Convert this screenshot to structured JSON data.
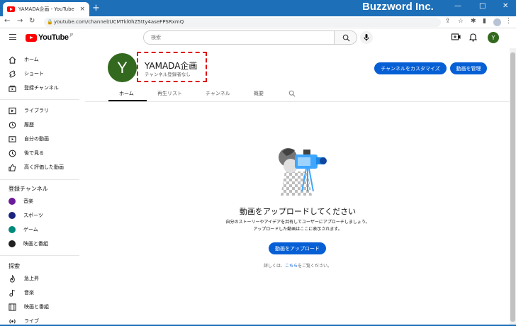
{
  "browser": {
    "tab_title": "YAMADA企画 - YouTube",
    "tab_close": "×",
    "new_tab": "+",
    "brand_overlay": "Buzzword Inc.",
    "url": "youtube.com/channel/UCMTkl0hZ5tty4aseFPSRxmQ",
    "window_controls": [
      "—",
      "□",
      "✕"
    ]
  },
  "header": {
    "logo_text": "YouTube",
    "logo_region": "JP",
    "search_placeholder": "検索",
    "user_initial": "Y"
  },
  "sidebar": {
    "main_items": [
      {
        "label": "ホーム",
        "icon": "home-icon"
      },
      {
        "label": "ショート",
        "icon": "shorts-icon"
      },
      {
        "label": "登録チャンネル",
        "icon": "subscriptions-icon"
      }
    ],
    "library_items": [
      {
        "label": "ライブラリ",
        "icon": "library-icon"
      },
      {
        "label": "履歴",
        "icon": "history-icon"
      },
      {
        "label": "自分の動画",
        "icon": "your-videos-icon"
      },
      {
        "label": "後で見る",
        "icon": "watch-later-icon"
      },
      {
        "label": "高く評価した動画",
        "icon": "liked-videos-icon"
      }
    ],
    "subscriptions_title": "登録チャンネル",
    "subscriptions": [
      {
        "label": "音楽",
        "color": "#6a1b9a"
      },
      {
        "label": "スポーツ",
        "color": "#1a237e"
      },
      {
        "label": "ゲーム",
        "color": "#00897b"
      },
      {
        "label": "映画と番組",
        "color": "#212121"
      }
    ],
    "explore_title": "探索",
    "explore_items": [
      {
        "label": "急上昇",
        "icon": "trending-icon"
      },
      {
        "label": "音楽",
        "icon": "music-icon"
      },
      {
        "label": "映画と番組",
        "icon": "movies-icon"
      },
      {
        "label": "ライブ",
        "icon": "live-icon"
      }
    ]
  },
  "channel": {
    "avatar_initial": "Y",
    "name": "YAMADA企画",
    "subscribers": "チャンネル登録者なし",
    "customize_button": "チャンネルをカスタマイズ",
    "manage_button": "動画を管理",
    "tabs": [
      "ホーム",
      "再生リスト",
      "チャンネル",
      "概要"
    ],
    "active_tab": "ホーム"
  },
  "empty_state": {
    "title": "動画をアップロードしてください",
    "desc_line1": "自分のストーリーやアイデアを共有してユーザーにアプローチしましょう。",
    "desc_line2": "アップロードした動画はここに表示されます。",
    "upload_button": "動画をアップロード",
    "learn_prefix": "詳しくは、",
    "learn_link": "こちら",
    "learn_suffix": "をご覧ください。"
  },
  "colors": {
    "accent": "#065fd4",
    "brand_red": "#ff0000",
    "avatar": "#33691e",
    "window_blue": "#1d6fb8",
    "highlight": "#dd1111"
  }
}
